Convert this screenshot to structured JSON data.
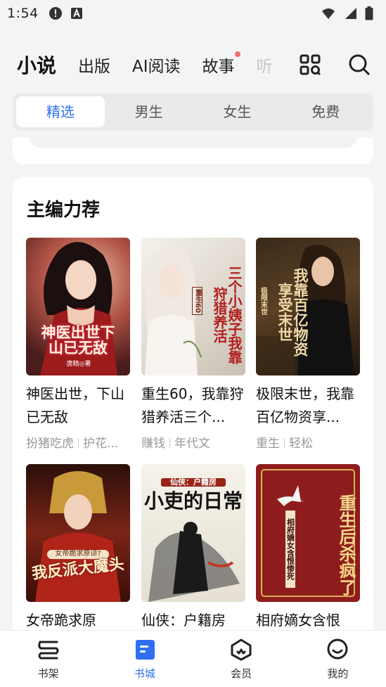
{
  "status": {
    "time": "1:54"
  },
  "top_nav": {
    "tabs": [
      {
        "label": "小说"
      },
      {
        "label": "出版"
      },
      {
        "label": "AI阅读"
      },
      {
        "label": "故事"
      },
      {
        "label": "听"
      }
    ]
  },
  "segments": [
    "精选",
    "男生",
    "女生",
    "免费"
  ],
  "section": {
    "title": "主编力荐",
    "books": [
      {
        "title": "神医出世，下山已无敌",
        "tags": [
          "扮猪吃虎",
          "护花..."
        ],
        "cover_text": "神医出世下山已无敌",
        "cover_author": "唐精◎著"
      },
      {
        "title": "重生60，我靠狩猎养活三个...",
        "tags": [
          "赚钱",
          "年代文"
        ],
        "cover_text": "三个小姨子我靠狩猎养活",
        "cover_author": "重生60"
      },
      {
        "title": "极限末世，我靠百亿物资享...",
        "tags": [
          "重生",
          "轻松"
        ],
        "cover_text": "我靠百亿物资享受末世",
        "cover_author": "极限末世"
      },
      {
        "title": "女帝跪求原",
        "tags": [],
        "cover_text": "我反派大魔头",
        "cover_author": "女帝跪求原谅?"
      },
      {
        "title": "仙侠：户籍房",
        "tags": [],
        "cover_text": "小吏的日常",
        "cover_author": "仙侠：户籍房"
      },
      {
        "title": "相府嫡女含恨",
        "tags": [],
        "cover_text": "重生后杀疯了",
        "cover_author": "相府嫡女含恨惨死"
      }
    ]
  },
  "bottom_nav": [
    {
      "label": "书架"
    },
    {
      "label": "书城"
    },
    {
      "label": "会员"
    },
    {
      "label": "我的"
    }
  ],
  "colors": {
    "accent": "#2f6ff0",
    "notify_dot": "#f26d6d"
  }
}
